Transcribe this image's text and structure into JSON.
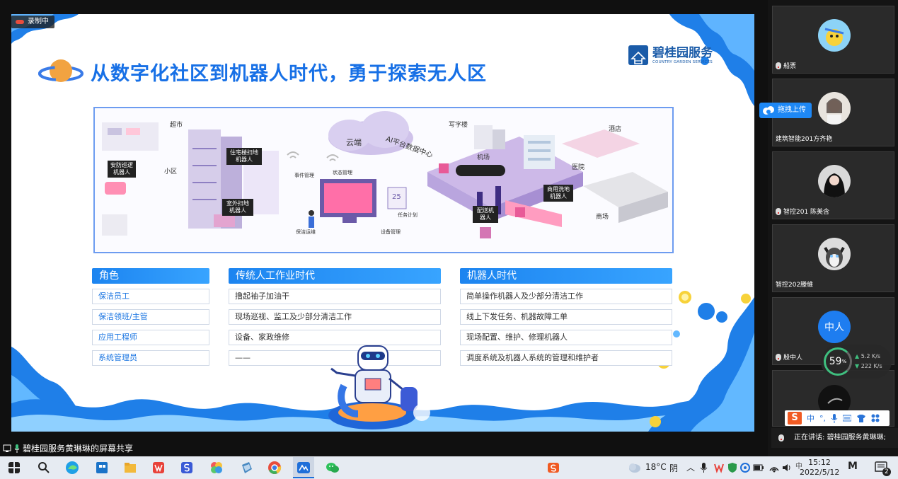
{
  "recording": {
    "label": "录制中"
  },
  "slide": {
    "title": "从数字化社区到机器人时代，勇于探索无人区",
    "logo_cn": "碧桂园服务",
    "logo_en": "COUNTRY GARDEN SERVICES",
    "scene_labels": {
      "supermarket": "超市",
      "cloud": "云端",
      "ai_center": "AI平台数据中心",
      "office": "写字楼",
      "hotel": "酒店",
      "community": "小区",
      "airport": "机场",
      "hospital": "医院",
      "mall": "商场",
      "event_mgmt": "事件管理",
      "status_mgmt": "状态管理",
      "task_plan": "任务计划",
      "device_mgmt": "设备管理",
      "cleaning_ops": "保洁运维",
      "date": "25"
    },
    "scene_tags": {
      "security_robot": "安防巡逻机器人",
      "indoor_clean": "住宅楼扫地机器人",
      "outdoor_clean": "室外扫地机器人",
      "delivery_robot": "配送机器人",
      "mall_clean": "商用洗地机器人"
    },
    "table": {
      "headers": [
        "角色",
        "传统人工作业时代",
        "机器人时代"
      ],
      "rows": [
        [
          "保洁员工",
          "撸起袖子加油干",
          "简单操作机器人及少部分清洁工作"
        ],
        [
          "保洁领班/主管",
          "现场巡视、监工及少部分清洁工作",
          "线上下发任务、机器故障工单"
        ],
        [
          "应用工程师",
          "设备、家政维修",
          "现场配置、维护、修理机器人"
        ],
        [
          "系统管理员",
          "——",
          "调度系统及机器人系统的管理和维护者"
        ]
      ]
    }
  },
  "share_caption": "碧桂园服务黄琳琳的屏幕共享",
  "participants": [
    {
      "name": "船票"
    },
    {
      "name": "建筑智能201方齐艳"
    },
    {
      "name": "智控201 陈美含"
    },
    {
      "name": "智控202滕維"
    },
    {
      "name": "殷中人",
      "avatar_text": "中人"
    },
    {
      "name": ""
    }
  ],
  "upload_button": "拖拽上传",
  "speaker_bar": "正在讲话: 碧桂园服务黄琳琳;",
  "netmon": {
    "percent": "59",
    "unit": "%",
    "up": "5.2",
    "down": "222",
    "speed_unit": "K/s"
  },
  "ime": {
    "logo": "S",
    "mode": "中",
    "punct": "°,"
  },
  "taskbar": {
    "weather_temp": "18°C",
    "weather_desc": "阴",
    "time": "15:12",
    "date": "2022/5/12",
    "notif_count": "2",
    "ime_indicator": "M"
  },
  "colors": {
    "accent": "#1c84f0",
    "title": "#1770e6",
    "brand": "#1a5ba8"
  }
}
